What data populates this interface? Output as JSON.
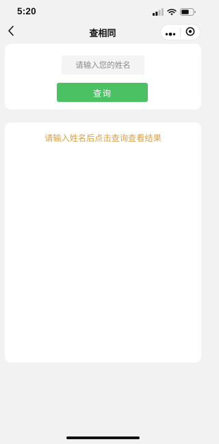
{
  "status_bar": {
    "time": "5:20",
    "icons": [
      "signal-icon",
      "wifi-icon",
      "battery-icon"
    ]
  },
  "nav": {
    "title": "查相同",
    "back_icon": "chevron-left-icon",
    "capsule_icons": [
      "more-dots-icon",
      "close-target-icon"
    ]
  },
  "search": {
    "placeholder": "请输入您的姓名",
    "value": "",
    "button_label": "查询"
  },
  "result": {
    "hint": "请输入姓名后点击查询查看结果"
  },
  "colors": {
    "primary_button": "#4cc164",
    "hint_text": "#d9a04a",
    "page_background": "#f2f2f2",
    "card_background": "#ffffff"
  }
}
